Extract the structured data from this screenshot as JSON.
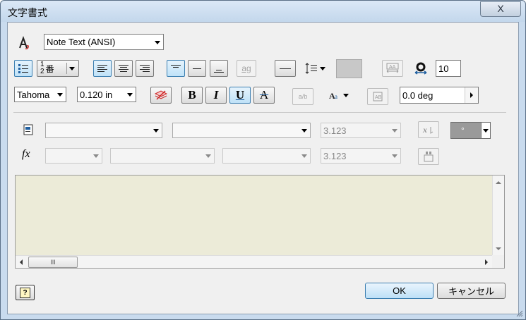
{
  "window": {
    "title": "文字書式",
    "close_glyph": "X"
  },
  "toolbar1": {
    "text_style": "Note Text (ANSI)"
  },
  "toolbar2": {
    "numbering_label": "番",
    "line_spacing_value": "10",
    "stack_icon_text": "ag"
  },
  "toolbar3": {
    "font": "Tahoma",
    "font_size": "0.120 in",
    "bold": "B",
    "italic": "I",
    "underline": "U",
    "strike": "A",
    "stack_text": "a/b",
    "rotation": "0.0 deg"
  },
  "param_row": {
    "value": "3.123",
    "symbol": "°"
  },
  "func_row": {
    "fx": "fx",
    "value": "3.123"
  },
  "scroll": {
    "thumb_glyph": "III"
  },
  "buttons": {
    "ok": "OK",
    "cancel": "キャンセル",
    "help": "?"
  },
  "colors": {
    "editor_bg": "#ecebd8",
    "window_frame": "#c9dbee",
    "active_toggle": "#bfe2f8"
  }
}
